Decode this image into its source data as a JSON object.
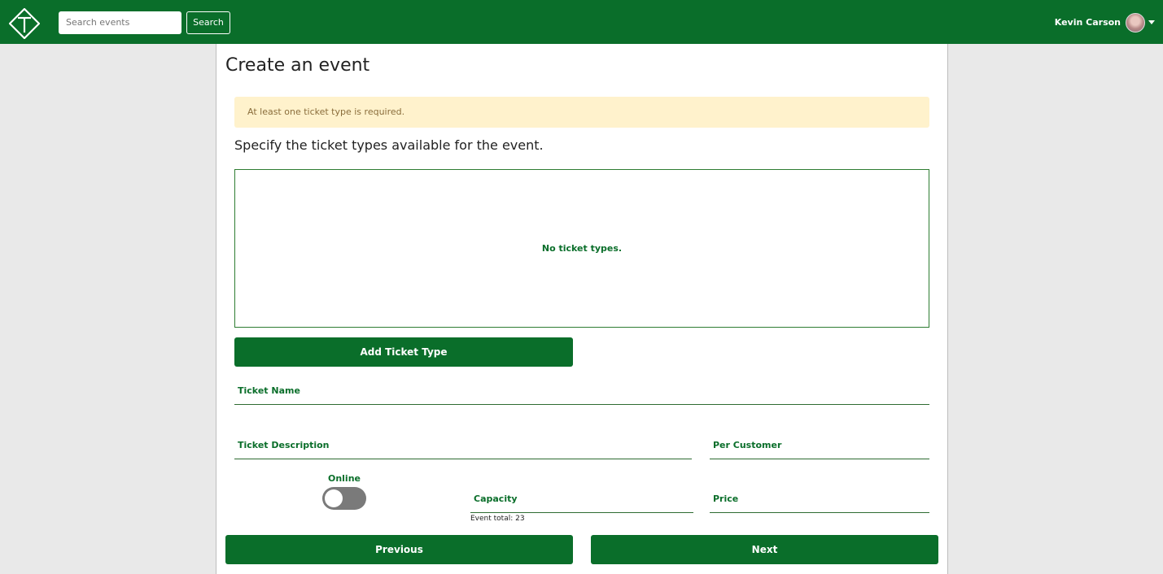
{
  "header": {
    "logo_icon": "ticket-t-diamond-icon",
    "search_placeholder": "Search events",
    "search_button": "Search",
    "user_name": "Kevin Carson",
    "avatar_icon": "user-avatar",
    "menu_icon": "caret-down-icon"
  },
  "form": {
    "title": "Create an event",
    "alert": "At least one ticket type is required.",
    "subtitle": "Specify the ticket types available for the event.",
    "empty_message": "No ticket types.",
    "add_button": "Add Ticket Type",
    "fields": {
      "ticket_name": "Ticket Name",
      "ticket_description": "Ticket Description",
      "per_customer": "Per Customer",
      "online": "Online",
      "capacity": "Capacity",
      "price": "Price"
    },
    "event_total": "Event total: 23",
    "online_enabled": false,
    "previous_button": "Previous",
    "next_button": "Next"
  },
  "colors": {
    "primary": "#0a6e2a",
    "alert_bg": "#fff2cc",
    "alert_text": "#8a6d3b",
    "page_bg": "#e9e9e9"
  }
}
